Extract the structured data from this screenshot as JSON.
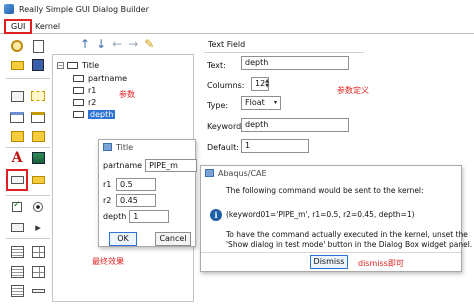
{
  "window": {
    "title": "Really Simple GUI Dialog Builder"
  },
  "tabs": {
    "gui": "GUI",
    "kernel": "Kernel"
  },
  "toolbox": {
    "icons": [
      "dialog-icon",
      "new-file-icon",
      "open-file-icon",
      "save-file-icon",
      "frame-icon",
      "tab-frame-icon",
      "group-box-icon",
      "dashed-frame-icon",
      "panel-icon",
      "panel-alt-icon",
      "label-icon",
      "image-icon",
      "text-field-icon",
      "combo-box-icon",
      "checkbox-icon",
      "radio-button-icon",
      "button-icon",
      "arrow-icon",
      "list-icon",
      "table-icon",
      "slider-icon",
      "spinner-icon"
    ]
  },
  "tree": {
    "toolbar": [
      "↑",
      "↓",
      "←",
      "→",
      "✎"
    ],
    "root": "Title",
    "items": [
      "partname",
      "r1",
      "r2",
      "depth"
    ],
    "selected": "depth",
    "annotation": "参数"
  },
  "properties": {
    "group_title": "Text Field",
    "text_label": "Text:",
    "text_value": "depth",
    "columns_label": "Columns:",
    "columns_value": "12",
    "type_label": "Type:",
    "type_value": "Float",
    "keyword_label": "Keyword:",
    "keyword_value": "depth",
    "default_label": "Default:",
    "default_value": "1",
    "annotation": "参数定义"
  },
  "preview_dialog": {
    "title": "Title",
    "fields": [
      {
        "label": "partname",
        "value": "PIPE_m"
      },
      {
        "label": "r1",
        "value": "0.5"
      },
      {
        "label": "r2",
        "value": "0.45"
      },
      {
        "label": "depth",
        "value": "1"
      }
    ],
    "ok": "OK",
    "cancel": "Cancel",
    "annotation": "最终效果"
  },
  "message_dialog": {
    "title": "Abaqus/CAE",
    "line1": "The following command would be sent to the kernel:",
    "command": "(keyword01='PIPE_m', r1=0.5, r2=0.45, depth=1)",
    "line3": "To have the command actually executed in the kernel, unset the",
    "line4": "'Show dialog in test mode' button in the Dialog Box widget panel.",
    "dismiss": "Dismiss",
    "annotation": "dismiss即可"
  },
  "colors": {
    "accent": "#2d73d2",
    "annotation_red": "#e02020"
  }
}
